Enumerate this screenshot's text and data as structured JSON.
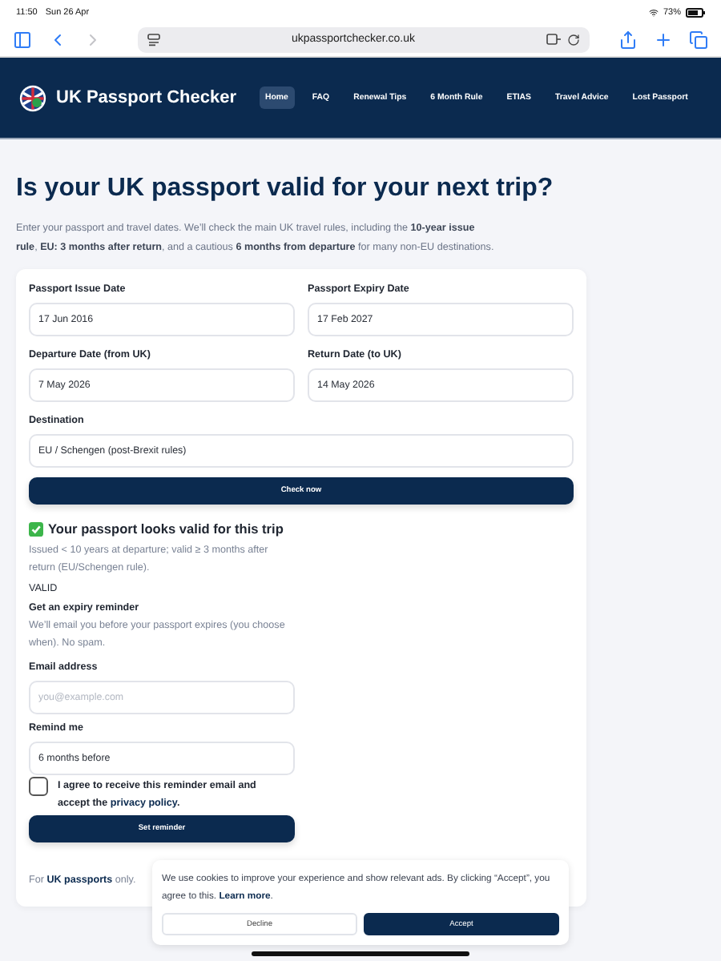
{
  "status_bar": {
    "time": "11:50",
    "date": "Sun 26 Apr",
    "battery": "73%"
  },
  "browser": {
    "url": "ukpassportchecker.co.uk"
  },
  "site_header": {
    "brand": "UK Passport Checker",
    "nav": [
      {
        "label": "Home",
        "selected": true
      },
      {
        "label": "FAQ",
        "selected": false
      },
      {
        "label": "Renewal Tips",
        "selected": false
      },
      {
        "label": "6 Month Rule",
        "selected": false
      },
      {
        "label": "ETIAS",
        "selected": false
      },
      {
        "label": "Travel Advice",
        "selected": false
      },
      {
        "label": "Lost Passport",
        "selected": false
      }
    ]
  },
  "hero": {
    "title": "Is your UK passport valid for your next trip?",
    "intro": "Enter your passport and travel dates. We’ll check the main UK travel rules, including the **10-year issue rule**, **EU: 3 months after return**, and a cautious **6 months from departure** for many non-EU destinations."
  },
  "checker": {
    "fields": [
      {
        "label": "Passport Issue Date",
        "value": "17 Jun 2016"
      },
      {
        "label": "Passport Expiry Date",
        "value": "17 Feb 2027"
      },
      {
        "label": "Departure Date (from UK)",
        "value": "7 May 2026"
      },
      {
        "label": "Return Date (to UK)",
        "value": "14 May 2026"
      }
    ],
    "destination": {
      "label": "Destination",
      "value": "EU / Schengen (post-Brexit rules)"
    },
    "check_button": "Check now"
  },
  "result": {
    "title": "Your passport looks valid for this trip",
    "detail": "Issued < 10 years at departure; valid ≥ 3 months after return (EU/Schengen rule).",
    "status": "VALID"
  },
  "reminder": {
    "heading": "Get an expiry reminder",
    "text": "We’ll email you before your passport expires (you choose when). No spam.",
    "email": {
      "label": "Email address",
      "placeholder": "you@example.com"
    },
    "remind_me": {
      "label": "Remind me",
      "value": "6 months before"
    },
    "consent": {
      "checked": false,
      "text": "I agree to receive this reminder email and accept the ",
      "link": "privacy policy",
      "tail": "."
    },
    "button": "Set reminder"
  },
  "footnote": {
    "text": "For ",
    "link": "UK passports",
    "tail": " only."
  },
  "cookie_banner": {
    "text": "We use cookies to improve your experience and show relevant ads. By clicking “Accept”, you agree to this. ",
    "link": "Learn more",
    "tail": ".",
    "buttons": [
      {
        "label": "Decline",
        "kind": "secondary"
      },
      {
        "label": "Accept",
        "kind": "primary"
      }
    ]
  }
}
